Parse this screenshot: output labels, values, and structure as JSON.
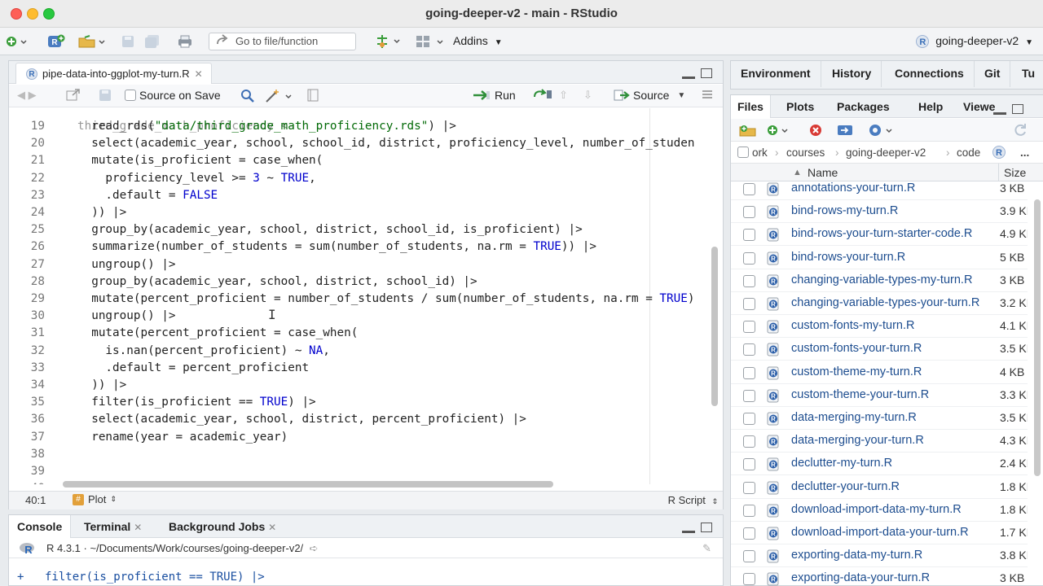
{
  "window": {
    "title": "going-deeper-v2 - main - RStudio"
  },
  "toolbar": {
    "goto_placeholder": "Go to file/function",
    "addins_label": "Addins",
    "project_label": "going-deeper-v2"
  },
  "editor": {
    "tab_label": "pipe-data-into-ggplot-my-turn.R",
    "source_on_save": "Source on Save",
    "run_label": "Run",
    "source_label": "Source",
    "status_position": "40:1",
    "status_scope": "Plot",
    "status_filetype": "R Script",
    "lines": [
      {
        "n": "19",
        "text": "  read_rds(\"data/third_grade_math_proficiency.rds\") |>"
      },
      {
        "n": "20",
        "text": "  select(academic_year, school, school_id, district, proficiency_level, number_of_studen"
      },
      {
        "n": "21",
        "text": "  mutate(is_proficient = case_when("
      },
      {
        "n": "22",
        "text": "    proficiency_level >= 3 ~ TRUE,"
      },
      {
        "n": "23",
        "text": "    .default = FALSE"
      },
      {
        "n": "24",
        "text": "  )) |>"
      },
      {
        "n": "25",
        "text": "  group_by(academic_year, school, district, school_id, is_proficient) |>"
      },
      {
        "n": "26",
        "text": "  summarize(number_of_students = sum(number_of_students, na.rm = TRUE)) |>"
      },
      {
        "n": "27",
        "text": "  ungroup() |>"
      },
      {
        "n": "28",
        "text": "  group_by(academic_year, school, district, school_id) |>"
      },
      {
        "n": "29",
        "text": "  mutate(percent_proficient = number_of_students / sum(number_of_students, na.rm = TRUE)"
      },
      {
        "n": "30",
        "text": "  ungroup() |>"
      },
      {
        "n": "31",
        "text": "  mutate(percent_proficient = case_when("
      },
      {
        "n": "32",
        "text": "    is.nan(percent_proficient) ~ NA,"
      },
      {
        "n": "33",
        "text": "    .default = percent_proficient"
      },
      {
        "n": "34",
        "text": "  )) |>"
      },
      {
        "n": "35",
        "text": "  filter(is_proficient == TRUE) |>"
      },
      {
        "n": "36",
        "text": "  select(academic_year, school, district, percent_proficient) |>"
      },
      {
        "n": "37",
        "text": "  rename(year = academic_year)"
      },
      {
        "n": "38",
        "text": ""
      },
      {
        "n": "39",
        "text": ""
      },
      {
        "n": "40",
        "text": ""
      }
    ]
  },
  "console": {
    "tabs": [
      "Console",
      "Terminal",
      "Background Jobs"
    ],
    "r_version": "R 4.3.1 · ~/Documents/Work/courses/going-deeper-v2/",
    "last_line": "filter(is_proficient == TRUE) |>",
    "prompt": "+"
  },
  "env_pane": {
    "tabs": [
      "Environment",
      "History",
      "Connections",
      "Git",
      "Tu"
    ]
  },
  "files_pane": {
    "tabs": [
      "Files",
      "Plots",
      "Packages",
      "Help",
      "Viewe"
    ],
    "breadcrumb": [
      "ork",
      "courses",
      "going-deeper-v2",
      "code"
    ],
    "col_name": "Name",
    "col_size": "Size",
    "files": [
      {
        "name": "annotations-your-turn.R",
        "size": "3 KB"
      },
      {
        "name": "bind-rows-my-turn.R",
        "size": "3.9 KB"
      },
      {
        "name": "bind-rows-your-turn-starter-code.R",
        "size": "4.9 KB"
      },
      {
        "name": "bind-rows-your-turn.R",
        "size": "5 KB"
      },
      {
        "name": "changing-variable-types-my-turn.R",
        "size": "3 KB"
      },
      {
        "name": "changing-variable-types-your-turn.R",
        "size": "3.2 KB"
      },
      {
        "name": "custom-fonts-my-turn.R",
        "size": "4.1 KB"
      },
      {
        "name": "custom-fonts-your-turn.R",
        "size": "3.5 KB"
      },
      {
        "name": "custom-theme-my-turn.R",
        "size": "4 KB"
      },
      {
        "name": "custom-theme-your-turn.R",
        "size": "3.3 KB"
      },
      {
        "name": "data-merging-my-turn.R",
        "size": "3.5 KB"
      },
      {
        "name": "data-merging-your-turn.R",
        "size": "4.3 KB"
      },
      {
        "name": "declutter-my-turn.R",
        "size": "2.4 KB"
      },
      {
        "name": "declutter-your-turn.R",
        "size": "1.8 KB"
      },
      {
        "name": "download-import-data-my-turn.R",
        "size": "1.8 KB"
      },
      {
        "name": "download-import-data-your-turn.R",
        "size": "1.7 KB"
      },
      {
        "name": "exporting-data-my-turn.R",
        "size": "3.8 KB"
      },
      {
        "name": "exporting-data-your-turn.R",
        "size": "3 KB"
      }
    ]
  }
}
